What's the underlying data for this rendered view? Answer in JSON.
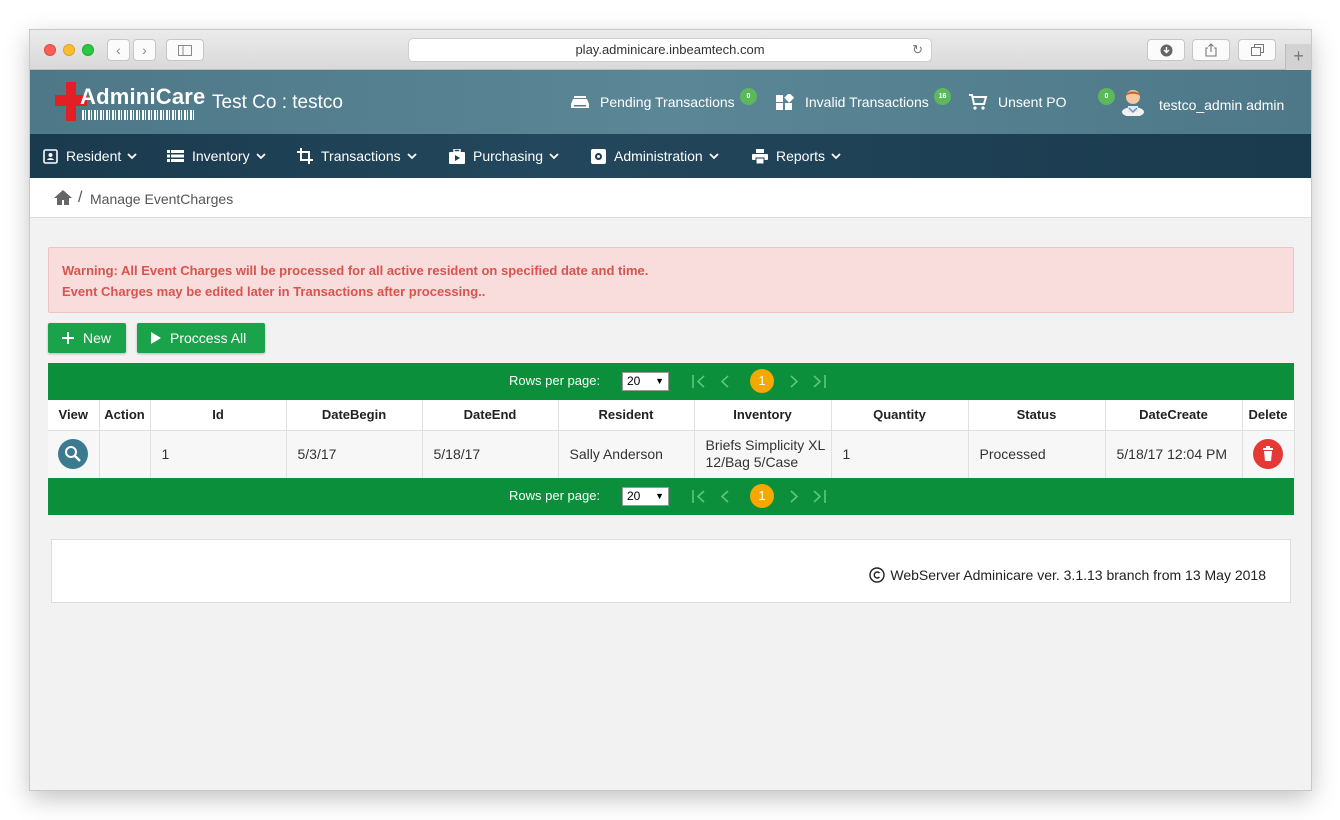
{
  "browser": {
    "url": "play.adminicare.inbeamtech.com"
  },
  "header": {
    "logo_text": "AdminiCare",
    "company": "Test Co : testco",
    "pending": {
      "label": "Pending Transactions",
      "count": "0",
      "icon": "inbox-icon"
    },
    "invalid": {
      "label": "Invalid Transactions",
      "count": "16",
      "icon": "widgets-icon"
    },
    "unsent": {
      "label": "Unsent PO",
      "count": "0",
      "icon": "cart-icon"
    },
    "user": "testco_admin admin"
  },
  "menu": [
    {
      "label": "Resident",
      "icon": "contact-card-icon"
    },
    {
      "label": "Inventory",
      "icon": "list-icon"
    },
    {
      "label": "Transactions",
      "icon": "crop-icon"
    },
    {
      "label": "Purchasing",
      "icon": "briefcase-icon"
    },
    {
      "label": "Administration",
      "icon": "settings-icon"
    },
    {
      "label": "Reports",
      "icon": "print-icon"
    }
  ],
  "breadcrumb": {
    "separator": "/",
    "current": "Manage EventCharges"
  },
  "warning": {
    "line1": "Warning: All Event Charges will be processed for all active resident on specified date and time.",
    "line2": "Event Charges may be edited later in Transactions after processing.."
  },
  "actions": {
    "new_label": "New",
    "process_label": "Proccess All"
  },
  "pager": {
    "rows_label": "Rows per page:",
    "rows_value": "20",
    "current_page": "1"
  },
  "table": {
    "headers": [
      "View",
      "Action",
      "Id",
      "DateBegin",
      "DateEnd",
      "Resident",
      "Inventory",
      "Quantity",
      "Status",
      "DateCreate",
      "Delete"
    ],
    "rows": [
      {
        "id": "1",
        "date_begin": "5/3/17",
        "date_end": "5/18/17",
        "resident": "Sally Anderson",
        "inventory": "Briefs Simplicity XL 12/Bag 5/Case",
        "quantity": "1",
        "status": "Processed",
        "date_create": "5/18/17 12:04 PM"
      }
    ]
  },
  "footer": {
    "text": "WebServer Adminicare ver. 3.1.13 branch from 13 May 2018"
  },
  "colors": {
    "header": "#4f7a8a",
    "menubar": "#1d3d50",
    "green": "#0b8f3a",
    "button_green": "#1aa34a",
    "page_badge": "#f5a800",
    "delete_red": "#e53935",
    "warning_text": "#d9534f"
  }
}
